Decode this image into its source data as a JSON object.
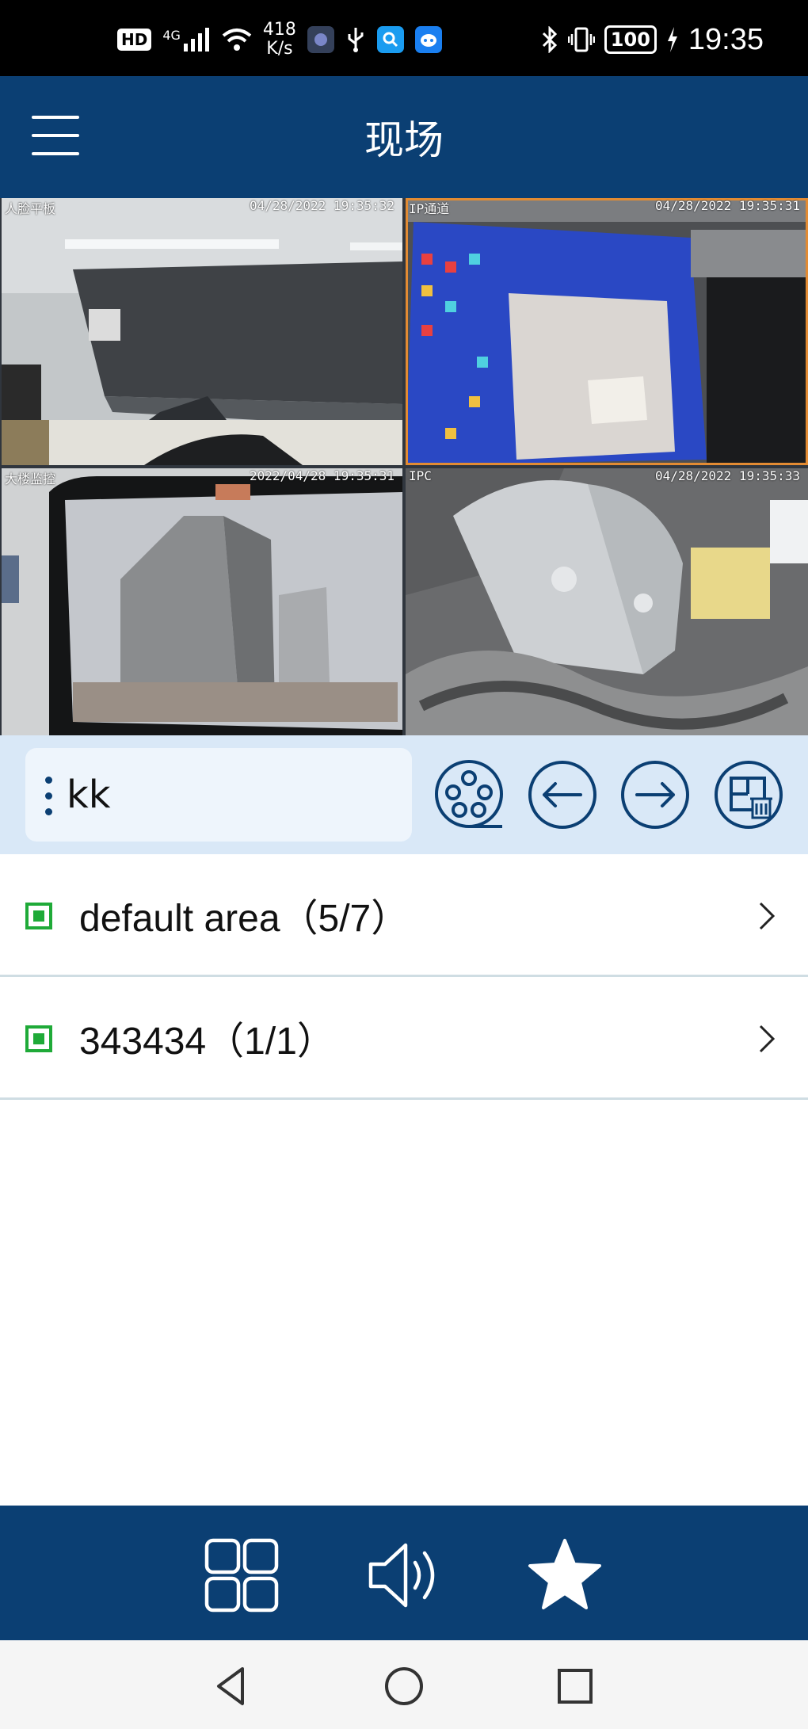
{
  "status_bar": {
    "hd": "HD",
    "network": "4G",
    "speed_value": "418",
    "speed_unit": "K/s",
    "battery": "100",
    "time": "19:35"
  },
  "header": {
    "title": "现场"
  },
  "cameras": [
    {
      "label": "人脸平板",
      "timestamp": "04/28/2022 19:35:32",
      "selected": false
    },
    {
      "label": "IP通道",
      "timestamp": "04/28/2022 19:35:31",
      "selected": true
    },
    {
      "label": "大楼监控",
      "timestamp": "2022/04/28 19:35:31",
      "selected": false
    },
    {
      "label": "IPC",
      "timestamp": "04/28/2022 19:35:33",
      "selected": false
    }
  ],
  "toolbar": {
    "search_value": "kk"
  },
  "groups": [
    {
      "name": "default area（5/7）"
    },
    {
      "name": "343434（1/1）"
    }
  ],
  "colors": {
    "primary": "#0b3f73",
    "toolbar_bg": "#d9e8f7",
    "selected_border": "#e28b33",
    "online_green": "#1faa38"
  }
}
